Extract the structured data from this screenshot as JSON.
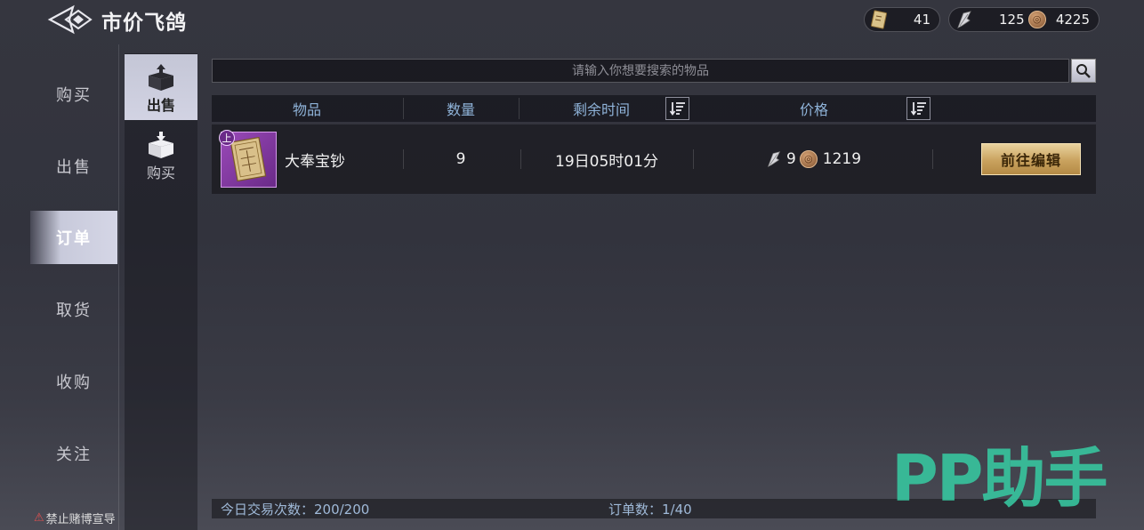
{
  "header": {
    "title": "市价飞鸽",
    "currencies": [
      {
        "icon": "ticket-icon",
        "value": "41"
      },
      {
        "icon": "feather-icon",
        "value": "125"
      },
      {
        "icon": "coin-icon",
        "value": "4225"
      }
    ]
  },
  "nav": {
    "items": [
      "购买",
      "出售",
      "订单",
      "取货",
      "收购",
      "关注"
    ],
    "active_index": 2
  },
  "subnav": {
    "items": [
      {
        "label": "出售",
        "icon": "box-out-icon",
        "active": true
      },
      {
        "label": "购买",
        "icon": "box-in-icon",
        "active": false
      }
    ]
  },
  "search": {
    "placeholder": "请输入你想要搜索的物品"
  },
  "table": {
    "headers": [
      "物品",
      "数量",
      "剩余时间",
      "价格"
    ],
    "rows": [
      {
        "badge": "上",
        "name": "大奉宝钞",
        "quantity": "9",
        "remaining": "19日05时01分",
        "price_feather": "9",
        "price_coin": "1219",
        "action": "前往编辑"
      }
    ]
  },
  "footer": {
    "trades_today": "今日交易次数：200/200",
    "order_count": "订单数：1/40"
  },
  "warning": "禁止赌博宣导",
  "watermark": "PP助手",
  "colors": {
    "header_text": "#8fb3d9",
    "gold_button": "#c9a25e",
    "watermark": "#37c8a0",
    "item_rarity": "#9a4ab8"
  }
}
